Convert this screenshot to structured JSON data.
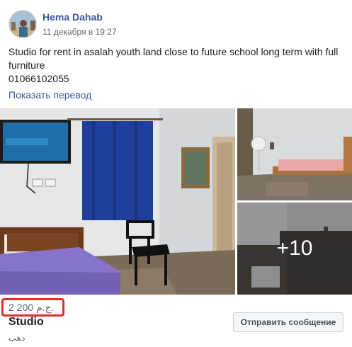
{
  "post": {
    "author": "Hema Dahab",
    "timestamp": "11 декабря в 19:27",
    "text_line1": "Studio for rent in asalah youth land close to future school long term with full",
    "text_line2": "furniture",
    "text_line3": "01066102055",
    "translate_link": "Показать перевод"
  },
  "photos": {
    "more_count": "+10"
  },
  "listing": {
    "price": "2 200 ج.م.",
    "title": "Studio",
    "location": "دهب",
    "message_button": "Отправить сообщение"
  },
  "colors": {
    "link": "#385898",
    "highlight_box": "#e0302a"
  }
}
